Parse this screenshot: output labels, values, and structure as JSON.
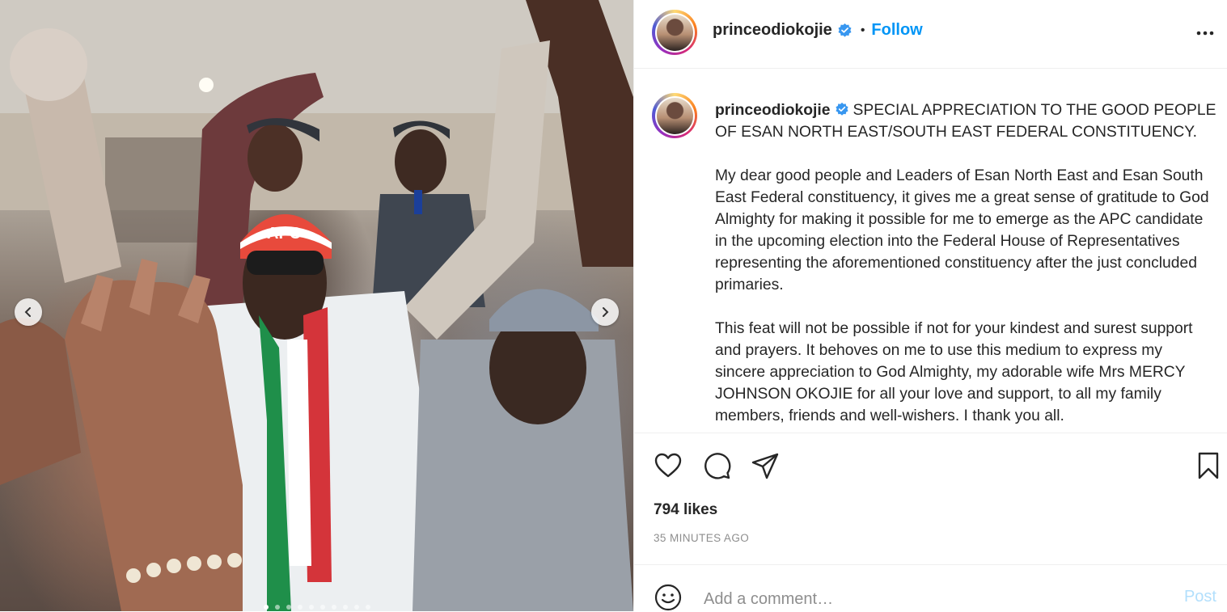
{
  "post": {
    "username": "princeodiokojie",
    "follow_label": "Follow",
    "caption_paragraphs": [
      "SPECIAL APPRECIATION TO THE GOOD PEOPLE OF ESAN NORTH EAST/SOUTH EAST FEDERAL CONSTITUENCY.",
      "My dear good people and Leaders of Esan North East and Esan South East Federal constituency, it gives me a great sense of gratitude to God Almighty for making it possible for me to emerge as the APC candidate in the upcoming election into the Federal House of Representatives representing the aforementioned constituency after the just concluded primaries.",
      "This feat will not be possible if not for your kindest and surest support and prayers. It behoves on me to use this medium to express my sincere appreciation to God Almighty, my adorable wife Mrs MERCY JOHNSON OKOJIE for all your love and support, to all my family members, friends and well-wishers. I thank you all."
    ],
    "likes": "794 likes",
    "timestamp": "35 MINUTES AGO"
  },
  "comment": {
    "placeholder": "Add a comment…",
    "post_label": "Post"
  },
  "media": {
    "cap_text": "APC",
    "carousel_count": 10,
    "carousel_active_index": 0
  },
  "icons": {
    "verified": "verified-badge-icon",
    "more": "more-options-icon",
    "like": "heart-icon",
    "comment": "comment-icon",
    "share": "share-icon",
    "save": "bookmark-icon",
    "emoji": "emoji-icon",
    "prev": "chevron-left-icon",
    "next": "chevron-right-icon"
  },
  "colors": {
    "link_blue": "#0095f6",
    "verified_blue": "#3897f0",
    "post_disabled": "#b2dffc",
    "muted_text": "#8e8e8e"
  }
}
